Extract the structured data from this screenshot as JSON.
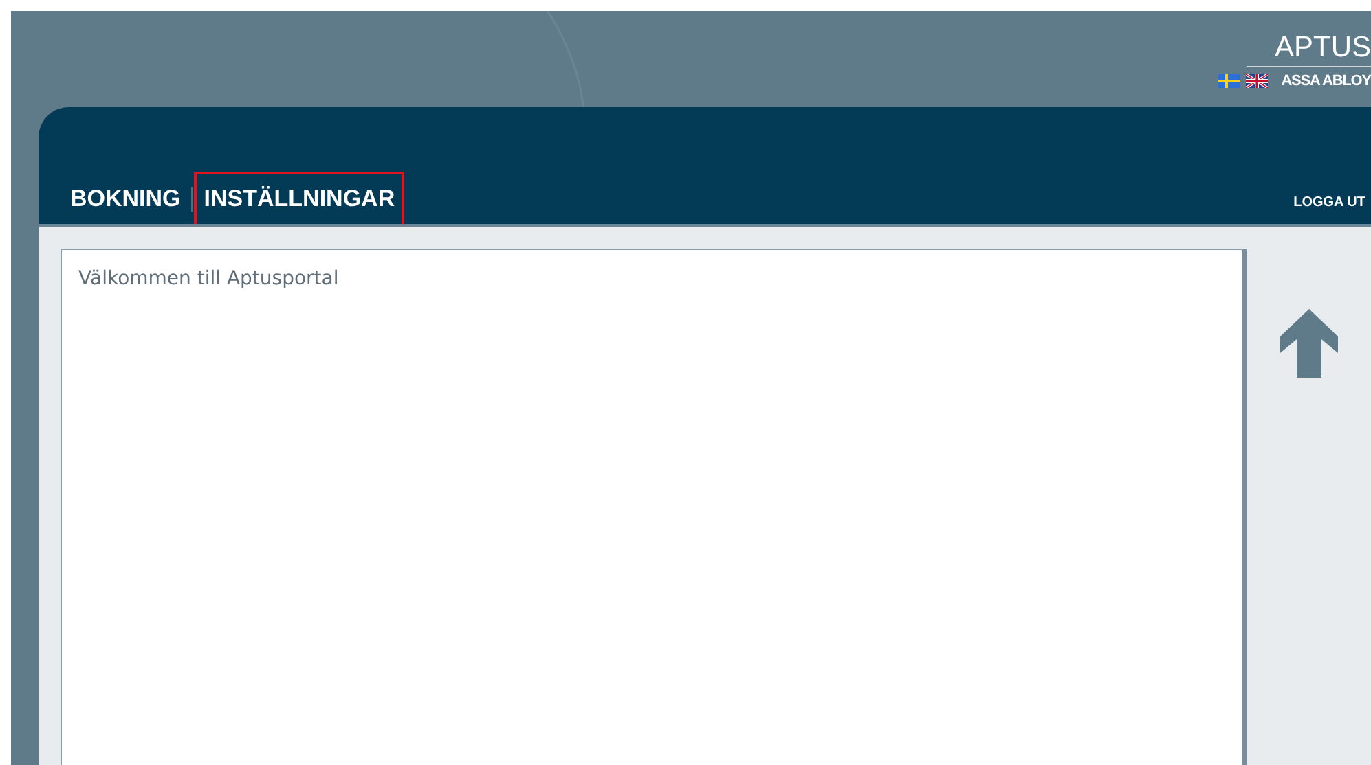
{
  "brand": {
    "logo": "APTUS",
    "company": "ASSA ABLOY"
  },
  "languages": [
    {
      "kind": "sv"
    },
    {
      "kind": "en"
    }
  ],
  "nav": [
    {
      "label": "BOKNING",
      "highlighted": false
    },
    {
      "label": "INSTÄLLNINGAR",
      "highlighted": true
    }
  ],
  "logout": "LOGGA UT",
  "content": {
    "welcome": "Välkommen till Aptusportal"
  }
}
